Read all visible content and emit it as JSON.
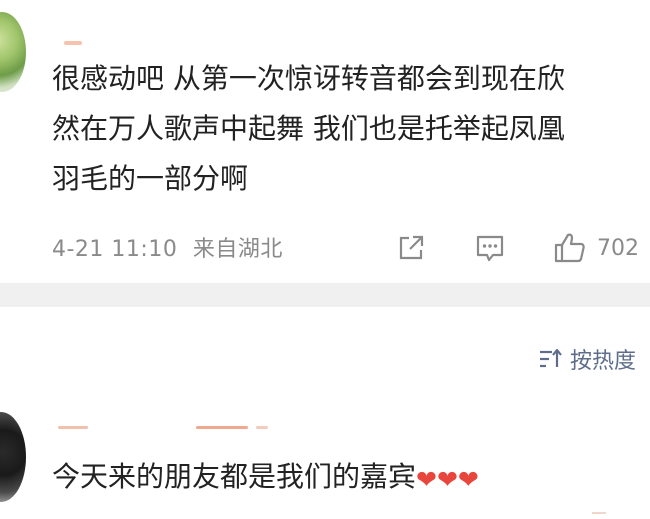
{
  "comment_1": {
    "lines": [
      "很感动吧 从第一次惊讶转音都会到现在欣",
      "然在万人歌声中起舞 我们也是托举起凤凰",
      "羽毛的一部分啊"
    ],
    "timestamp": "4-21 11:10",
    "location": "来自湖北",
    "like_count": "702"
  },
  "sort": {
    "label": "按热度"
  },
  "comment_2": {
    "text": "今天来的朋友都是我们的嘉宾",
    "hearts": [
      "❤",
      "❤",
      "❤"
    ]
  },
  "colors": {
    "text": "#222222",
    "meta": "#8a8a8a",
    "divider": "#f0f0f0",
    "sort": "#5e6e8a",
    "heart": "#e8453c"
  },
  "icons": {
    "share": "share-icon",
    "reply": "comment-icon",
    "like": "thumbs-up-icon",
    "sort": "sort-icon"
  }
}
